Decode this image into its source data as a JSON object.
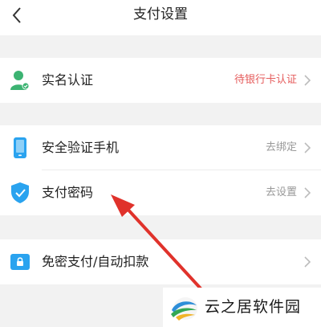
{
  "header": {
    "title": "支付设置"
  },
  "sections": {
    "identity": {
      "label": "实名认证",
      "value": "待银行卡认证"
    },
    "phone": {
      "label": "安全验证手机",
      "value": "去绑定"
    },
    "password": {
      "label": "支付密码",
      "value": "去设置"
    },
    "autopay": {
      "label": "免密支付/自动扣款",
      "value": ""
    }
  },
  "watermark": {
    "text": "云之居软件园"
  },
  "colors": {
    "accent_blue": "#2aa3ef",
    "green": "#3cb372",
    "alert_red": "#e55b5b",
    "arrow_red": "#e0322b"
  }
}
